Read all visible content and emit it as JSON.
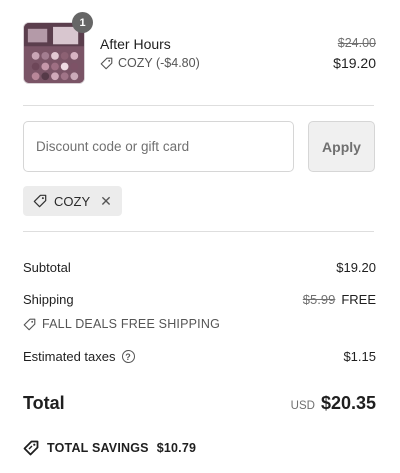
{
  "product": {
    "quantity": "1",
    "name": "After Hours",
    "discount_text": "COZY (-$4.80)",
    "original_price": "$24.00",
    "price": "$19.20"
  },
  "discount": {
    "placeholder": "Discount code or gift card",
    "apply_label": "Apply",
    "applied_code": "COZY"
  },
  "summary": {
    "subtotal_label": "Subtotal",
    "subtotal_value": "$19.20",
    "shipping_label": "Shipping",
    "shipping_original": "$5.99",
    "shipping_value": "FREE",
    "shipping_promo": "FALL DEALS FREE SHIPPING",
    "taxes_label": "Estimated taxes",
    "taxes_value": "$1.15",
    "total_label": "Total",
    "currency": "USD",
    "total_value": "$20.35",
    "savings_label": "TOTAL SAVINGS",
    "savings_value": "$10.79"
  },
  "icons": {
    "tag": "tag-icon",
    "help": "help-circle-icon",
    "close": "close-icon",
    "savings": "savings-tag-icon"
  },
  "colors": {
    "muted_text": "#707070",
    "divider": "#dedede",
    "badge": "#666666",
    "chip_bg": "#ececec"
  }
}
